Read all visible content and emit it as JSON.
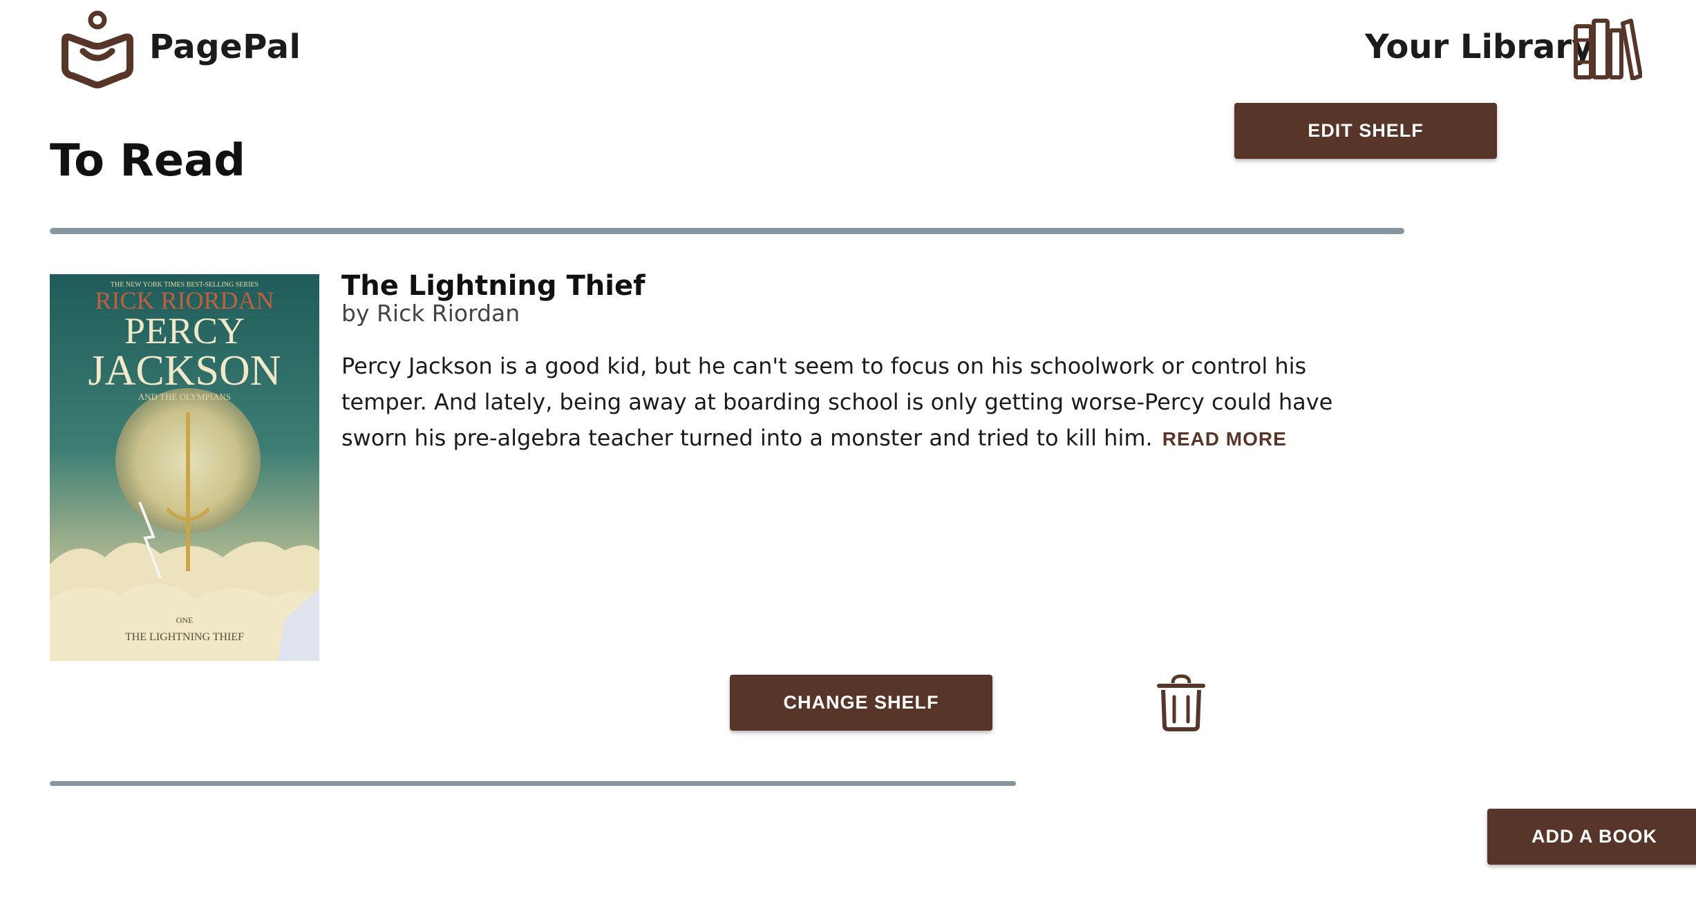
{
  "header": {
    "brand": "PagePal",
    "library_link": "Your Library",
    "logo_icon": "open-book-person-logo",
    "library_icon": "bookshelf-icon"
  },
  "shelf": {
    "title": "To Read",
    "edit_label": "EDIT SHELF",
    "add_book_label": "ADD A BOOK"
  },
  "book": {
    "title": "The Lightning Thief",
    "author": "by Rick Riordan",
    "description": "Percy Jackson is a good kid, but he can't seem to focus on his schoolwork or control his temper. And lately, being away at boarding school is only getting worse-Percy could have sworn his pre-algebra teacher turned into a monster and tried to kill him.",
    "read_more": "READ MORE",
    "change_shelf_label": "CHANGE SHELF",
    "delete_icon": "trash-icon",
    "cover": {
      "banner": "THE NEW YORK TIMES BEST-SELLING SERIES",
      "author": "RICK RIORDAN",
      "series_line1": "PERCY",
      "series_line2": "JACKSON",
      "series_sub": "AND THE OLYMPIANS",
      "book_number": "ONE",
      "book_title": "THE LIGHTNING THIEF"
    }
  },
  "colors": {
    "accent": "#573529",
    "divider": "#8795a1",
    "cover_teal": "#2f6e6b"
  }
}
